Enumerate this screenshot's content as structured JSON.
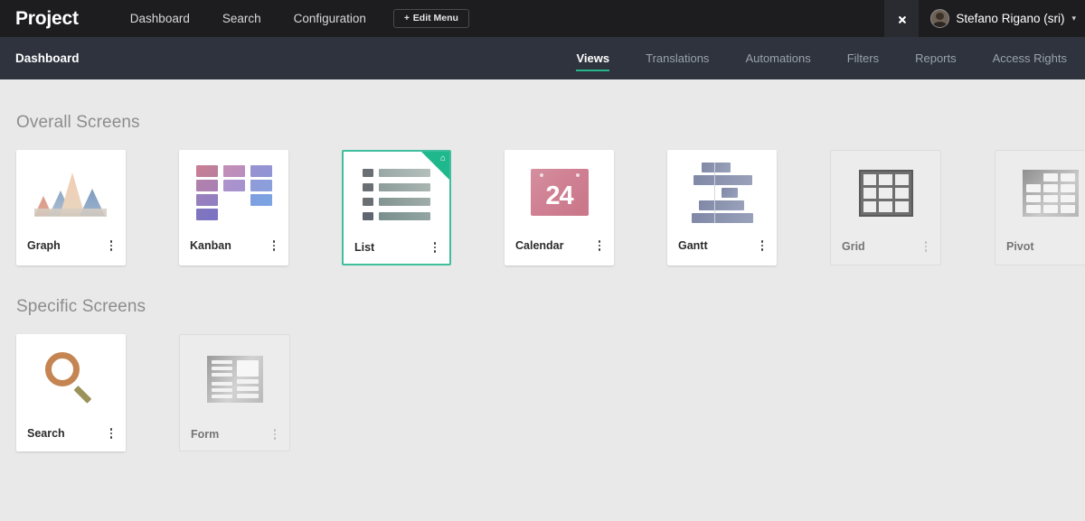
{
  "header": {
    "brand": "Project",
    "nav": [
      {
        "label": "Dashboard"
      },
      {
        "label": "Search"
      },
      {
        "label": "Configuration"
      }
    ],
    "edit_menu_label": "Edit Menu",
    "edit_menu_plus": "+",
    "tools_icon": "tools-icon",
    "user": {
      "name": "Stefano Rigano (sri)",
      "caret": "▾"
    }
  },
  "subheader": {
    "title": "Dashboard",
    "tabs": [
      {
        "label": "Views",
        "active": true
      },
      {
        "label": "Translations",
        "active": false
      },
      {
        "label": "Automations",
        "active": false
      },
      {
        "label": "Filters",
        "active": false
      },
      {
        "label": "Reports",
        "active": false
      },
      {
        "label": "Access Rights",
        "active": false
      }
    ]
  },
  "sections": [
    {
      "title": "Overall Screens",
      "cards": [
        {
          "label": "Graph",
          "icon": "graph-icon",
          "state": "normal"
        },
        {
          "label": "Kanban",
          "icon": "kanban-icon",
          "state": "normal"
        },
        {
          "label": "List",
          "icon": "list-icon",
          "state": "selected",
          "ribbon_icon": "⌂"
        },
        {
          "label": "Calendar",
          "icon": "calendar-icon",
          "state": "normal",
          "day": "24"
        },
        {
          "label": "Gantt",
          "icon": "gantt-icon",
          "state": "normal"
        },
        {
          "label": "Grid",
          "icon": "grid-icon",
          "state": "disabled"
        },
        {
          "label": "Pivot",
          "icon": "pivot-icon",
          "state": "disabled"
        }
      ]
    },
    {
      "title": "Specific Screens",
      "cards": [
        {
          "label": "Search",
          "icon": "search-icon",
          "state": "normal"
        },
        {
          "label": "Form",
          "icon": "form-icon",
          "state": "disabled"
        }
      ]
    }
  ],
  "colors": {
    "topbar_bg": "#1d1d1f",
    "subbar_bg": "#2e333d",
    "page_bg": "#e9e9e9",
    "accent_green": "#27b68c",
    "selected_border": "#3fbf9c",
    "ribbon": "#1fb88c"
  }
}
